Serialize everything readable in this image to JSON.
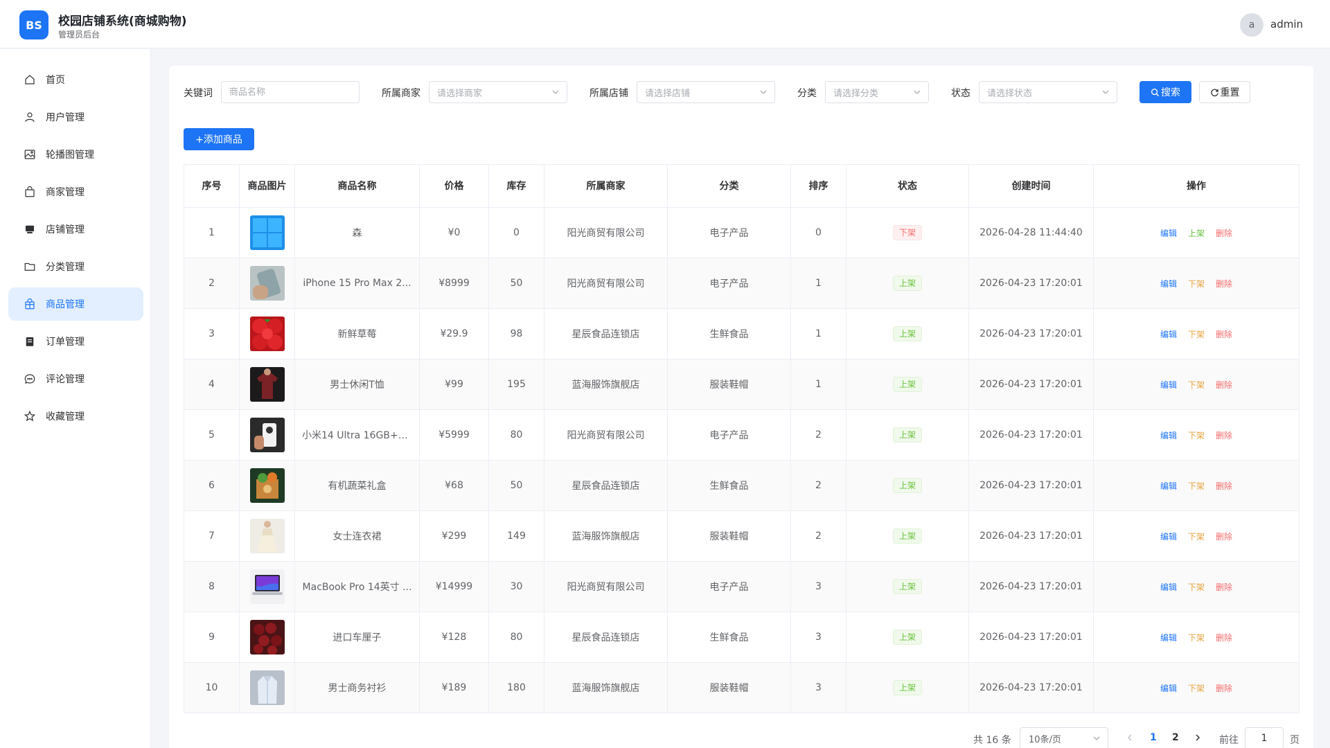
{
  "header": {
    "logo_text": "BS",
    "title": "校园店铺系统(商城购物)",
    "subtitle": "管理员后台",
    "avatar_letter": "a",
    "username": "admin"
  },
  "sidebar": {
    "items": [
      {
        "label": "首页",
        "icon": "home-icon"
      },
      {
        "label": "用户管理",
        "icon": "user-icon"
      },
      {
        "label": "轮播图管理",
        "icon": "image-icon"
      },
      {
        "label": "商家管理",
        "icon": "bag-icon"
      },
      {
        "label": "店铺管理",
        "icon": "shop-icon"
      },
      {
        "label": "分类管理",
        "icon": "folder-icon"
      },
      {
        "label": "商品管理",
        "icon": "goods-icon",
        "active": true
      },
      {
        "label": "订单管理",
        "icon": "order-icon"
      },
      {
        "label": "评论管理",
        "icon": "chat-icon"
      },
      {
        "label": "收藏管理",
        "icon": "star-icon"
      }
    ]
  },
  "filters": {
    "keyword_label": "关键词",
    "keyword_placeholder": "商品名称",
    "keyword_value": "",
    "merchant_label": "所属商家",
    "merchant_placeholder": "请选择商家",
    "shop_label": "所属店铺",
    "shop_placeholder": "请选择店铺",
    "category_label": "分类",
    "category_placeholder": "请选择分类",
    "status_label": "状态",
    "status_placeholder": "请选择状态",
    "search_label": "搜索",
    "reset_label": "重置"
  },
  "add_button_label": "+添加商品",
  "table": {
    "columns": [
      "序号",
      "商品图片",
      "商品名称",
      "价格",
      "库存",
      "所属商家",
      "分类",
      "排序",
      "状态",
      "创建时间",
      "操作"
    ],
    "actions": {
      "edit": "编辑",
      "on_shelf": "上架",
      "off_shelf": "下架",
      "delete": "删除"
    },
    "rows": [
      {
        "no": "1",
        "image": "windows-logo",
        "name": "森",
        "price": "¥0",
        "stock": "0",
        "merchant": "阳光商贸有限公司",
        "category": "电子产品",
        "sort": "0",
        "status": "下架",
        "created": "2026-04-28 11:44:40",
        "toggle": "上架"
      },
      {
        "no": "2",
        "image": "iphone-photo",
        "name": "iPhone 15 Pro Max 2...",
        "price": "¥8999",
        "stock": "50",
        "merchant": "阳光商贸有限公司",
        "category": "电子产品",
        "sort": "1",
        "status": "上架",
        "created": "2026-04-23 17:20:01",
        "toggle": "下架"
      },
      {
        "no": "3",
        "image": "strawberry-photo",
        "name": "新鲜草莓",
        "price": "¥29.9",
        "stock": "98",
        "merchant": "星辰食品连锁店",
        "category": "生鲜食品",
        "sort": "1",
        "status": "上架",
        "created": "2026-04-23 17:20:01",
        "toggle": "下架"
      },
      {
        "no": "4",
        "image": "tshirt-photo",
        "name": "男士休闲T恤",
        "price": "¥99",
        "stock": "195",
        "merchant": "蓝海服饰旗舰店",
        "category": "服装鞋帽",
        "sort": "1",
        "status": "上架",
        "created": "2026-04-23 17:20:01",
        "toggle": "下架"
      },
      {
        "no": "5",
        "image": "phone-photo",
        "name": "小米14 Ultra 16GB+5...",
        "price": "¥5999",
        "stock": "80",
        "merchant": "阳光商贸有限公司",
        "category": "电子产品",
        "sort": "2",
        "status": "上架",
        "created": "2026-04-23 17:20:01",
        "toggle": "下架"
      },
      {
        "no": "6",
        "image": "veggie-box-photo",
        "name": "有机蔬菜礼盒",
        "price": "¥68",
        "stock": "50",
        "merchant": "星辰食品连锁店",
        "category": "生鲜食品",
        "sort": "2",
        "status": "上架",
        "created": "2026-04-23 17:20:01",
        "toggle": "下架"
      },
      {
        "no": "7",
        "image": "dress-photo",
        "name": "女士连衣裙",
        "price": "¥299",
        "stock": "149",
        "merchant": "蓝海服饰旗舰店",
        "category": "服装鞋帽",
        "sort": "2",
        "status": "上架",
        "created": "2026-04-23 17:20:01",
        "toggle": "下架"
      },
      {
        "no": "8",
        "image": "macbook-photo",
        "name": "MacBook Pro 14英寸 ...",
        "price": "¥14999",
        "stock": "30",
        "merchant": "阳光商贸有限公司",
        "category": "电子产品",
        "sort": "3",
        "status": "上架",
        "created": "2026-04-23 17:20:01",
        "toggle": "下架"
      },
      {
        "no": "9",
        "image": "cherry-photo",
        "name": "进口车厘子",
        "price": "¥128",
        "stock": "80",
        "merchant": "星辰食品连锁店",
        "category": "生鲜食品",
        "sort": "3",
        "status": "上架",
        "created": "2026-04-23 17:20:01",
        "toggle": "下架"
      },
      {
        "no": "10",
        "image": "shirt-photo",
        "name": "男士商务衬衫",
        "price": "¥189",
        "stock": "180",
        "merchant": "蓝海服饰旗舰店",
        "category": "服装鞋帽",
        "sort": "3",
        "status": "上架",
        "created": "2026-04-23 17:20:01",
        "toggle": "下架"
      }
    ]
  },
  "pagination": {
    "total_text": "共 16 条",
    "page_size": "10条/页",
    "pages": [
      "1",
      "2"
    ],
    "current_page": "1",
    "goto_label": "前往",
    "goto_value": "1",
    "page_suffix": "页"
  },
  "colors": {
    "primary": "#1d74f5",
    "success": "#67c23a",
    "warning": "#e6a23c",
    "danger": "#f56c6c"
  }
}
